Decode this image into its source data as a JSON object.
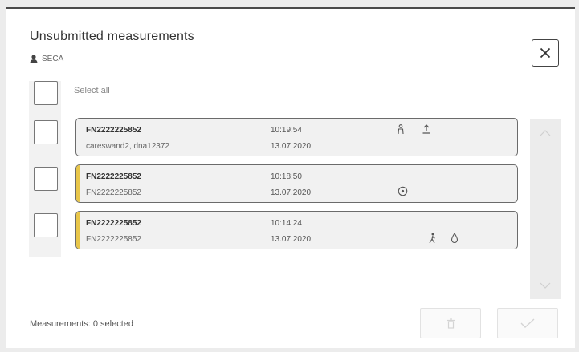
{
  "dialog": {
    "title": "Unsubmitted measurements",
    "user": "SECA"
  },
  "select_all_label": "Select all",
  "measurements": [
    {
      "id": "FN2222225852",
      "subtitle": "careswand2, dna12372",
      "time": "10:19:54",
      "date": "13.07.2020",
      "flagged": false,
      "icons": [
        "person-icon",
        "upload-icon"
      ]
    },
    {
      "id": "FN2222225852",
      "subtitle": "FN2222225852",
      "time": "10:18:50",
      "date": "13.07.2020",
      "flagged": true,
      "icons": [
        "circle-icon"
      ]
    },
    {
      "id": "FN2222225852",
      "subtitle": "FN2222225852",
      "time": "10:14:24",
      "date": "13.07.2020",
      "flagged": true,
      "icons": [
        "walking-icon",
        "drop-icon"
      ]
    }
  ],
  "footer": {
    "status": "Measurements: 0 selected"
  },
  "colors": {
    "flag": "#e8c64a",
    "border": "#6b6b6b"
  }
}
